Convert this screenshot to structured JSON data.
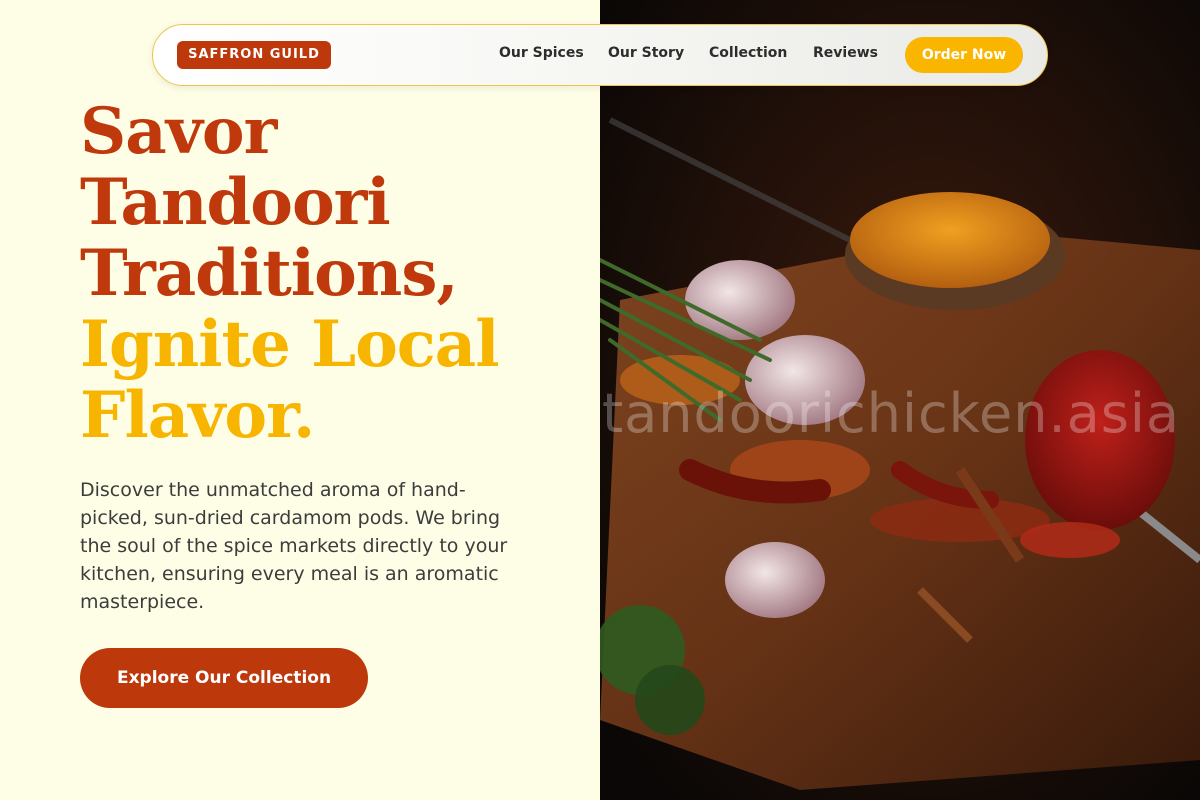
{
  "nav": {
    "brand": "SAFFRON GUILD",
    "links": [
      "Our Spices",
      "Our Story",
      "Collection",
      "Reviews"
    ],
    "order_label": "Order Now"
  },
  "hero": {
    "headline_lines_rust": [
      "Savor",
      "Tandoori",
      "Traditions,"
    ],
    "headline_lines_gold": [
      "Ignite Local",
      "Flavor."
    ],
    "description": "Discover the unmatched aroma of hand-picked, sun-dried cardamom pods. We bring the soul of the spice markets directly to your kitchen, ensuring every meal is an aromatic masterpiece.",
    "cta_label": "Explore Our Collection"
  },
  "image": {
    "watermark": "tandoorichicken.asia"
  },
  "colors": {
    "rust": "#bd380b",
    "gold": "#f7b500",
    "background": "#fefee6"
  }
}
